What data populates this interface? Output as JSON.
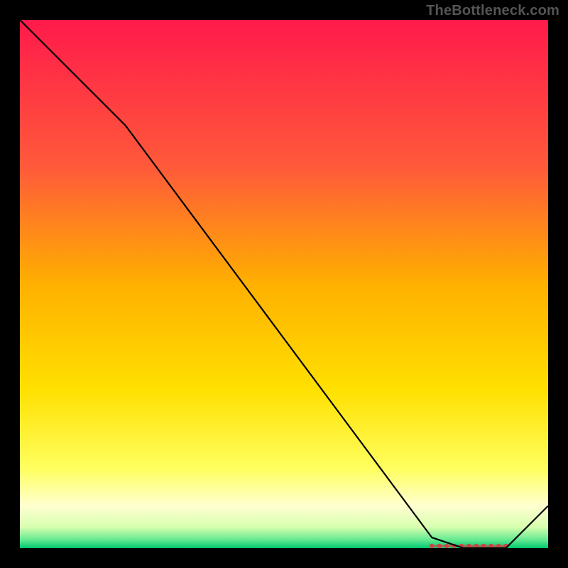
{
  "watermark": "TheBottleneck.com",
  "chart_data": {
    "type": "line",
    "title": "",
    "xlabel": "",
    "ylabel": "",
    "xlim": [
      0,
      100
    ],
    "ylim": [
      0,
      100
    ],
    "x": [
      0,
      20,
      78,
      84,
      92,
      100
    ],
    "values": [
      100,
      80,
      2,
      0,
      0,
      8
    ],
    "marker_band": {
      "x0": 78,
      "x1": 92,
      "y": 0
    },
    "background_gradient": {
      "stops": [
        {
          "offset": 0,
          "color": "#ff1a4b"
        },
        {
          "offset": 0.28,
          "color": "#ff5a3a"
        },
        {
          "offset": 0.5,
          "color": "#ffb000"
        },
        {
          "offset": 0.7,
          "color": "#ffe000"
        },
        {
          "offset": 0.85,
          "color": "#ffff60"
        },
        {
          "offset": 0.92,
          "color": "#ffffd0"
        },
        {
          "offset": 0.96,
          "color": "#d8ffb0"
        },
        {
          "offset": 0.985,
          "color": "#60e890"
        },
        {
          "offset": 1.0,
          "color": "#00c870"
        }
      ]
    },
    "line_color": "#000000",
    "marker_color": "#cc4444"
  }
}
